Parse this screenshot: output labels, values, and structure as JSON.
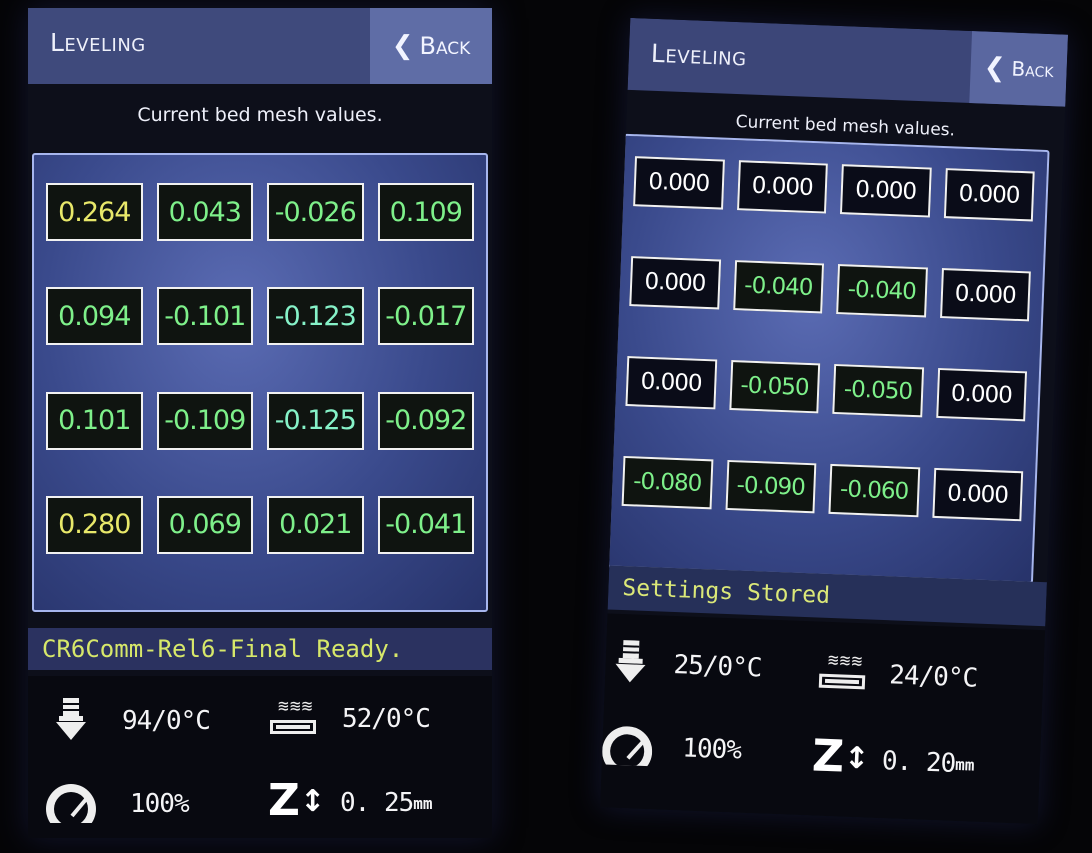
{
  "screens": [
    {
      "header": {
        "title": "Leveling",
        "back_label": "Back"
      },
      "subtitle": "Current bed mesh values.",
      "mesh": [
        [
          "0.264",
          "0.043",
          "-0.026",
          "0.109"
        ],
        [
          "0.094",
          "-0.101",
          "-0.123",
          "-0.017"
        ],
        [
          "0.101",
          "-0.109",
          "-0.125",
          "-0.092"
        ],
        [
          "0.280",
          "0.069",
          "0.021",
          "-0.041"
        ]
      ],
      "status": "CR6Comm-Rel6-Final Ready.",
      "hotend_temp": "94/0°C",
      "bed_temp": "52/0°C",
      "speed": "100%",
      "z_value": "0. 25",
      "z_unit": "mm"
    },
    {
      "header": {
        "title": "Leveling",
        "back_label": "Back"
      },
      "subtitle": "Current bed mesh values.",
      "mesh": [
        [
          "0.000",
          "0.000",
          "0.000",
          "0.000"
        ],
        [
          "0.000",
          "-0.040",
          "-0.040",
          "0.000"
        ],
        [
          "0.000",
          "-0.050",
          "-0.050",
          "0.000"
        ],
        [
          "-0.080",
          "-0.090",
          "-0.060",
          "0.000"
        ]
      ],
      "status": "Settings Stored",
      "hotend_temp": "25/0°C",
      "bed_temp": "24/0°C",
      "speed": "100%",
      "z_value": "0. 20",
      "z_unit": "mm"
    }
  ],
  "icons": {
    "back": "chevron-left-icon",
    "hotend": "nozzle-icon",
    "bed": "heated-bed-icon",
    "speed": "gauge-icon",
    "z": "z-axis-icon"
  },
  "colors": {
    "header_bg": "#3f4a7c",
    "back_bg": "#5f6da6",
    "panel_border": "#a7b6ee",
    "status_text": "#d7e86a",
    "value_yellow": "#e8e86a",
    "value_green": "#7ef08a",
    "value_white": "#ffffff"
  }
}
